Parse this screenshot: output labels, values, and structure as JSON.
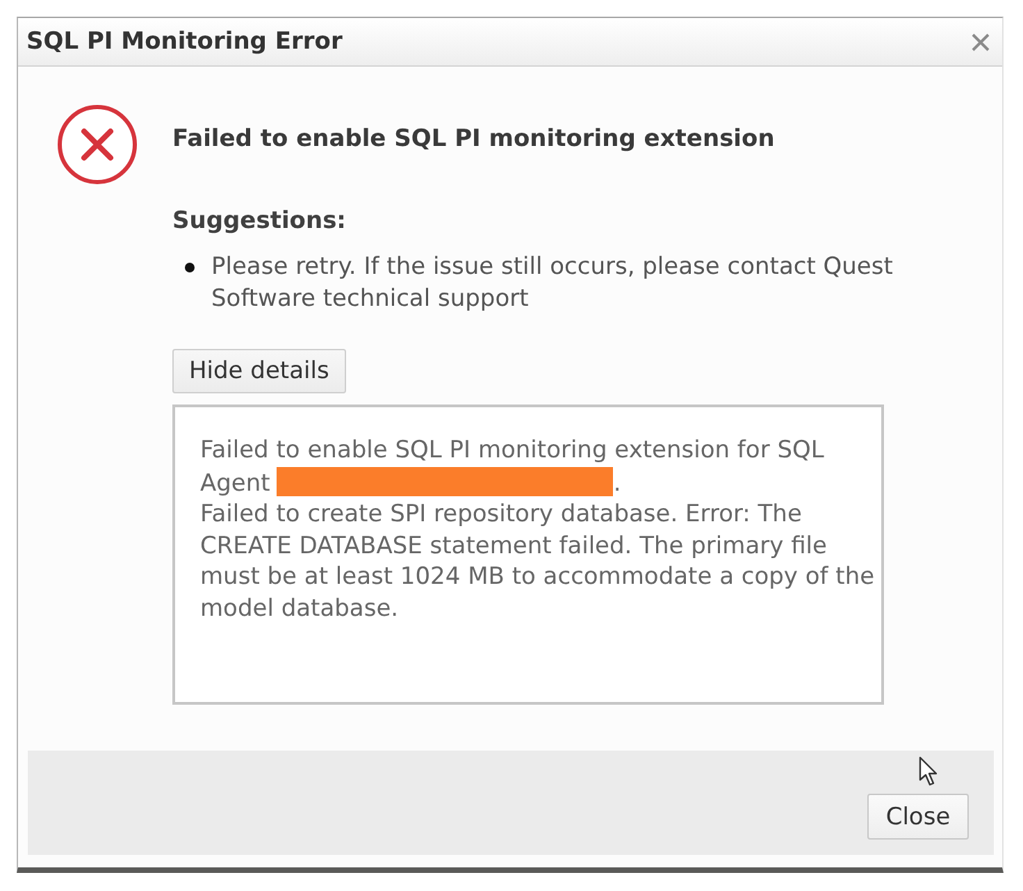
{
  "window": {
    "title": "SQL PI Monitoring Error"
  },
  "message": {
    "kind": "error",
    "heading": "Failed to enable SQL PI monitoring extension"
  },
  "suggestions": {
    "title": "Suggestions:",
    "items": [
      "Please retry. If the issue still occurs, please contact Quest Software technical support"
    ]
  },
  "details_button": {
    "label": "Hide details"
  },
  "details": {
    "expanded": true,
    "paragraphs": [
      {
        "text": "Failed to enable SQL PI monitoring extension for SQL Agent",
        "redacted": true,
        "after": "."
      },
      {
        "text": "Failed to create SPI repository database. Error: The CREATE DATABASE statement failed. The primary file must be at least 1024 MB to accommodate a copy of the model database.",
        "redacted": false
      }
    ]
  },
  "footer": {
    "buttons": [
      "Close"
    ]
  }
}
